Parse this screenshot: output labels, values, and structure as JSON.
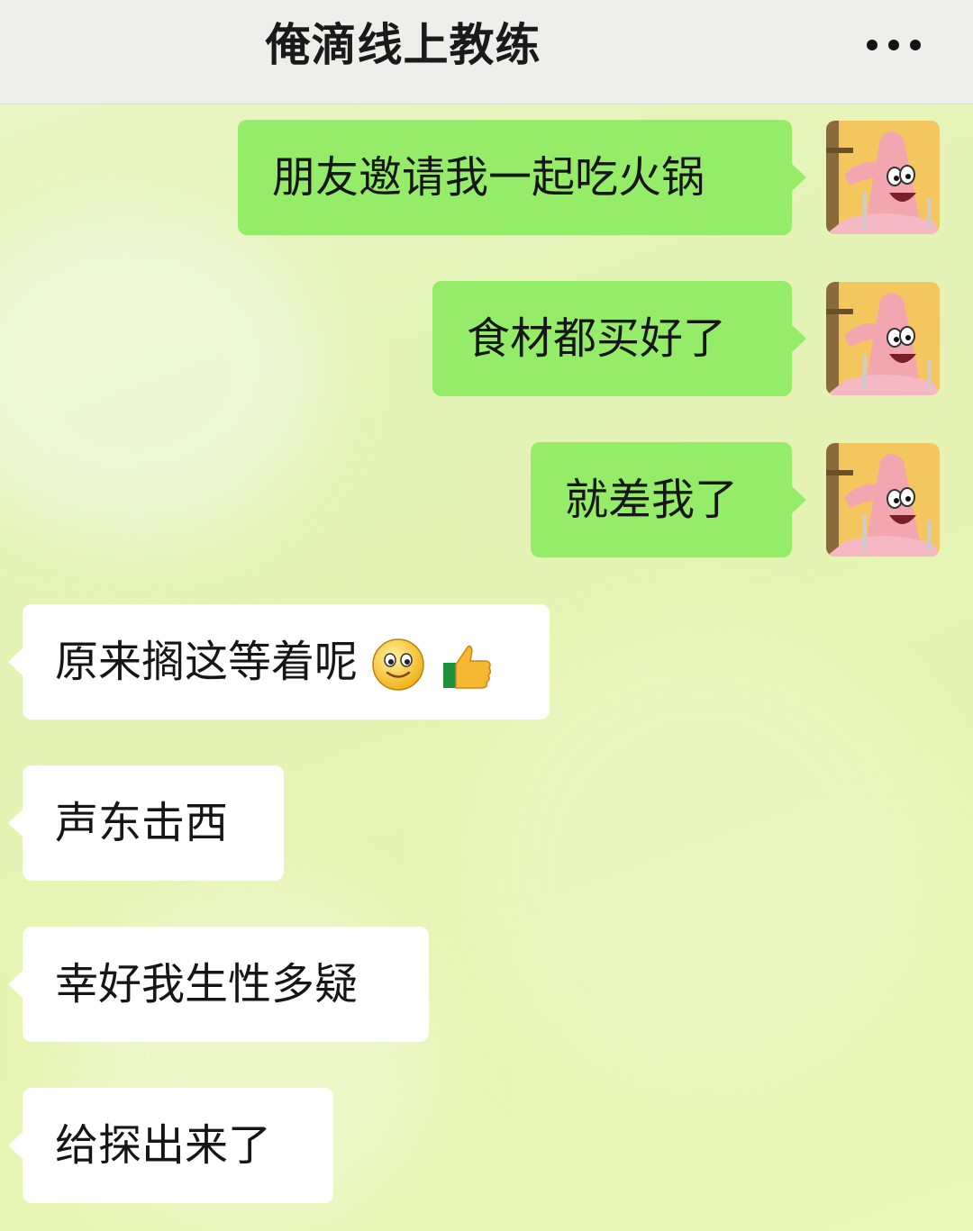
{
  "header": {
    "title": "俺滴线上教练",
    "more_icon": "more-dots-icon"
  },
  "messages": [
    {
      "side": "sent",
      "text": "朋友邀请我一起吃火锅"
    },
    {
      "side": "sent",
      "text": "食材都买好了"
    },
    {
      "side": "sent",
      "text": "就差我了"
    },
    {
      "side": "received",
      "text": "原来搁这等着呢",
      "emojis": [
        "smile-emoji",
        "thumbs-up-emoji"
      ]
    },
    {
      "side": "received",
      "text": "声东击西"
    },
    {
      "side": "received",
      "text": "幸好我生性多疑"
    },
    {
      "side": "received",
      "text": "给探出来了"
    }
  ],
  "colors": {
    "sent_bubble": "#95ec69",
    "received_bubble": "#ffffff",
    "header_bg": "#eeeeec"
  }
}
